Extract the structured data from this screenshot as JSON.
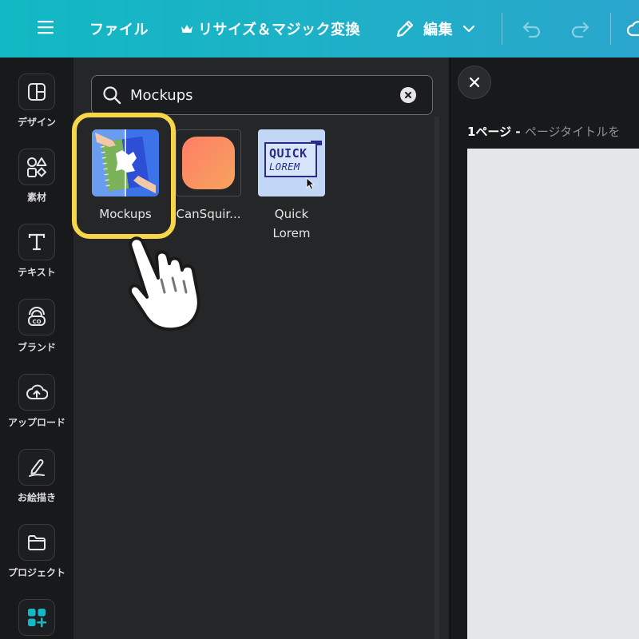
{
  "topbar": {
    "menu_icon": "hamburger-icon",
    "file_label": "ファイル",
    "resize_label": "リサイズ＆マジック変換",
    "resize_icon": "crown-icon",
    "edit_label": "編集",
    "edit_icon": "pencil-icon",
    "undo_icon": "undo-icon",
    "redo_icon": "redo-icon",
    "cloud_icon": "cloud-icon"
  },
  "sidebar": {
    "items": [
      {
        "label": "デザイン",
        "icon": "design-layout-icon"
      },
      {
        "label": "素材",
        "icon": "elements-shapes-icon"
      },
      {
        "label": "テキスト",
        "icon": "text-t-icon"
      },
      {
        "label": "ブランド",
        "icon": "brand-icon"
      },
      {
        "label": "アップロード",
        "icon": "cloud-upload-icon"
      },
      {
        "label": "お絵描き",
        "icon": "draw-pen-icon"
      },
      {
        "label": "プロジェクト",
        "icon": "folder-icon"
      },
      {
        "label": "",
        "icon": "apps-grid-icon"
      }
    ]
  },
  "search": {
    "value": "Mockups",
    "clear_icon": "clear-x-icon",
    "search_icon": "search-icon"
  },
  "results": [
    {
      "label": "Mockups",
      "highlighted": true
    },
    {
      "label": "CanSquir..."
    },
    {
      "label": "Quick\nLorem",
      "label_line1": "Quick",
      "label_line2": "Lorem",
      "thumb_text_1": "QUICK",
      "thumb_text_2": "LOREM"
    }
  ],
  "canvas": {
    "close_icon": "close-icon",
    "page_number": "1ページ - ",
    "page_title_placeholder": "ページタイトルを"
  },
  "colors": {
    "topbar_gradient_start": "#12b8c3",
    "topbar_gradient_end": "#2aa6cc",
    "highlight_ring": "#f7d64a",
    "panel_bg": "#252627",
    "app_bg": "#18191b"
  }
}
